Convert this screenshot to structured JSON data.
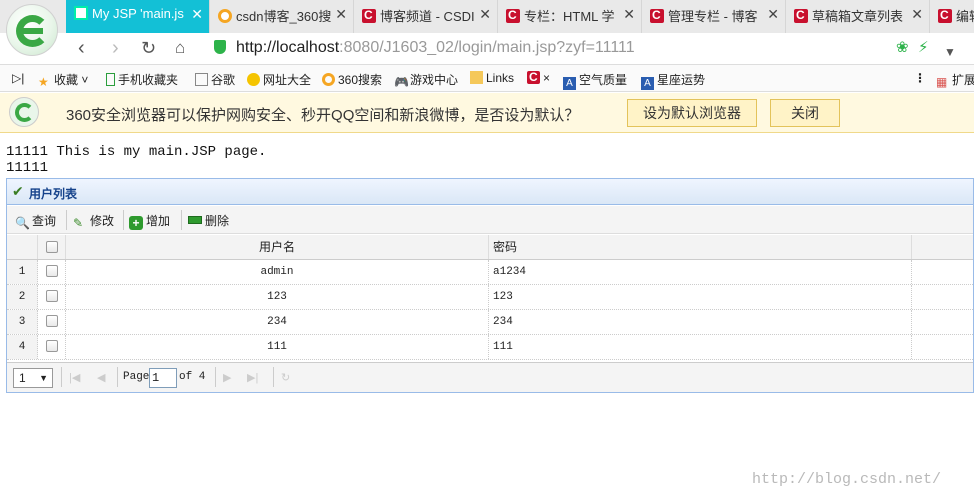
{
  "browser": {
    "tabs": [
      {
        "label": "My JSP 'main.js",
        "active": true
      },
      {
        "label": "csdn博客_360搜",
        "active": false
      },
      {
        "label": "博客频道 - CSDI",
        "active": false
      },
      {
        "label": "专栏：HTML 学",
        "active": false
      },
      {
        "label": "管理专栏 - 博客",
        "active": false
      },
      {
        "label": "草稿箱文章列表",
        "active": false
      },
      {
        "label": "编辑",
        "active": false
      }
    ],
    "url_host": "http://localhost",
    "url_rest": ":8080/J1603_02/login/main.jsp?zyf=11111",
    "bookmarks": [
      "收藏",
      "手机收藏夹",
      "谷歌",
      "网址大全",
      "360搜索",
      "游戏中心",
      "Links",
      "×",
      "空气质量",
      "星座运势",
      "扩展"
    ],
    "notice": {
      "text": "360安全浏览器可以保护网购安全、秒开QQ空间和新浪微博，是否设为默认？",
      "set_default_label": "设为默认浏览器",
      "close_label": "关闭"
    }
  },
  "page": {
    "line1": "11111 This is my main.JSP page.",
    "line2": "11111"
  },
  "panel": {
    "title": "用户列表",
    "toolbar": {
      "query": "查询",
      "edit": "修改",
      "add": "增加",
      "delete": "删除"
    },
    "columns": [
      "用户名",
      "密码"
    ],
    "rows": [
      {
        "num": "1",
        "username": "admin",
        "password": "a1234"
      },
      {
        "num": "2",
        "username": "123",
        "password": "123"
      },
      {
        "num": "3",
        "username": "234",
        "password": "234"
      },
      {
        "num": "4",
        "username": "111",
        "password": "111"
      }
    ],
    "pager": {
      "page_size": "1",
      "page_label": "Page",
      "current_page": "1",
      "of_label": "of 4"
    }
  },
  "watermark": "http://blog.csdn.net/",
  "colors": {
    "accent": "#13c0d6",
    "notice_bg": "#fff9e0",
    "panel_border": "#99bbe8",
    "panel_title": "#15428b"
  }
}
